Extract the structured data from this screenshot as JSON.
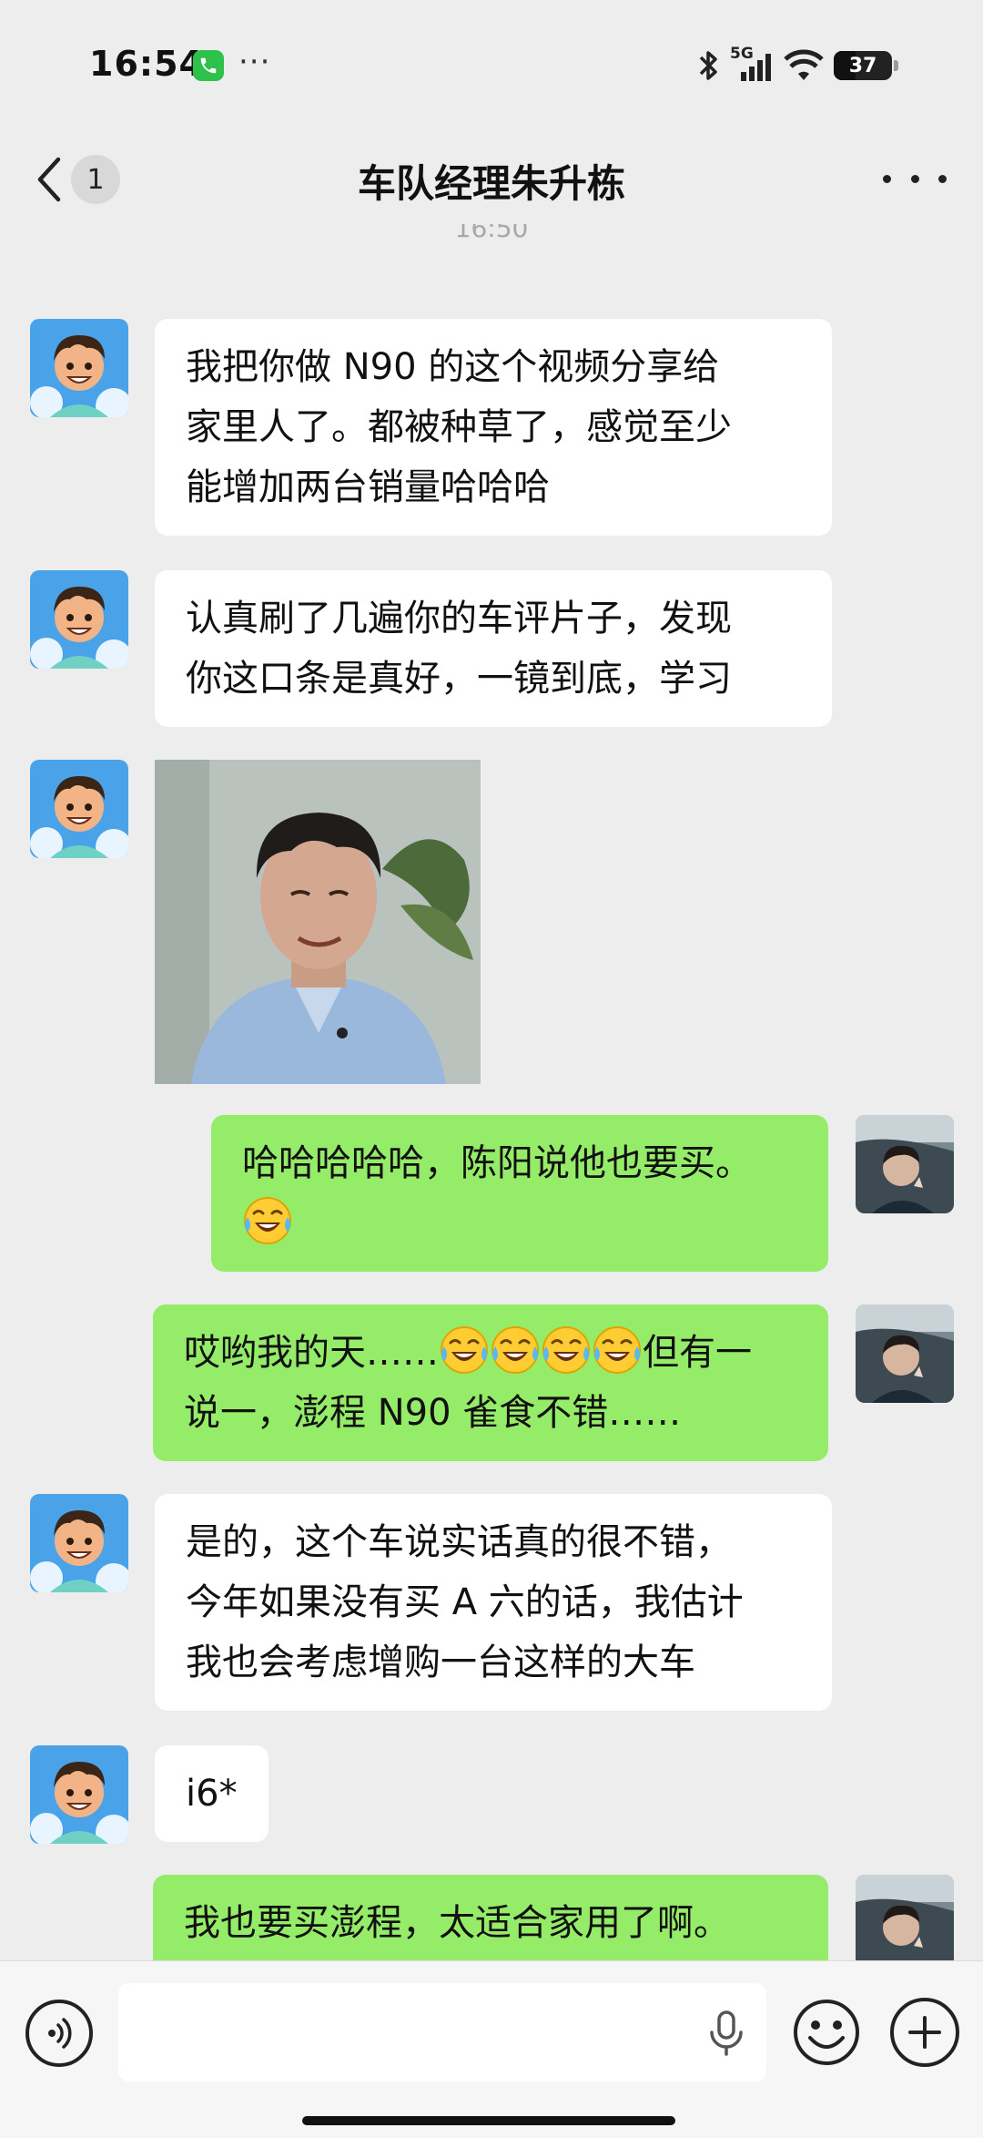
{
  "status_bar": {
    "time": "16:54",
    "more": "···",
    "network": "5G",
    "battery": "37",
    "battery_level": 0.37
  },
  "header": {
    "unread_count": "1",
    "title": "车队经理朱升栋"
  },
  "time_divider": "16:50",
  "messages": [
    {
      "side": "left",
      "type": "text",
      "lines": [
        "我把你做 N90 的这个视频分享给",
        "家里人了。都被种草了，感觉至少",
        "能增加两台销量哈哈哈"
      ]
    },
    {
      "side": "left",
      "type": "text",
      "lines": [
        "认真刷了几遍你的车评片子，发现",
        "你这口条是真好，一镜到底，学习"
      ]
    },
    {
      "side": "left",
      "type": "image",
      "icon": "photo-man-smiling"
    },
    {
      "side": "right",
      "type": "text",
      "lines": [
        "哈哈哈哈哈，陈阳说他也要买。",
        ""
      ]
    },
    {
      "side": "right",
      "type": "text",
      "lines": [
        "哎哟我的天……",
        "但有一",
        "说一，澎程 N90 雀食不错……"
      ]
    },
    {
      "side": "left",
      "type": "text",
      "lines": [
        "是的，这个车说实话真的很不错，",
        "今年如果没有买 A 六的话，我估计",
        "我也会考虑增购一台这样的大车"
      ]
    },
    {
      "side": "left",
      "type": "text",
      "lines": [
        "i6*"
      ]
    },
    {
      "side": "right",
      "type": "text",
      "lines": [
        "我也要买澎程，太适合家用了啊。"
      ]
    }
  ],
  "icons": {
    "emoji": "tears-of-joy-emoji",
    "voice": "voice-icon",
    "mic": "mic-icon",
    "sticker": "emoji-icon",
    "plus": "plus-icon"
  },
  "colors": {
    "background": "#ededed",
    "bubble_green": "#95ec69",
    "bubble_white": "#ffffff"
  }
}
